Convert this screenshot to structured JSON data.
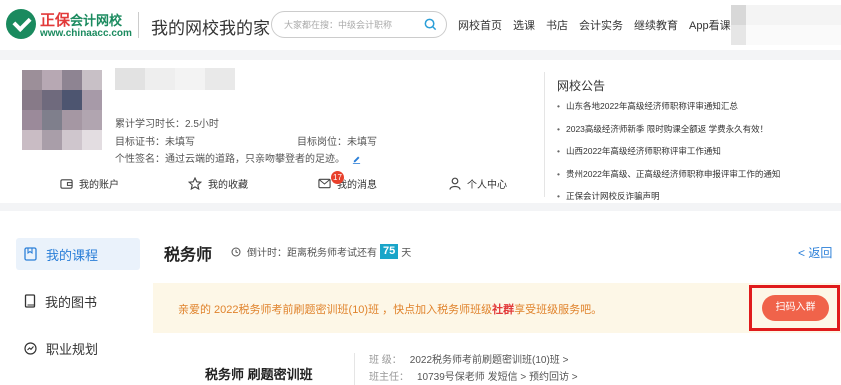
{
  "header": {
    "logo_main": "正保",
    "logo_sub": "会计网校",
    "logo_url": "www.chinaacc.com",
    "site_title": "我的网校我的家",
    "search_placeholder": "大家都在搜：中级会计职称",
    "nav": [
      "网校首页",
      "选课",
      "书店",
      "会计实务",
      "继续教育",
      "App看课"
    ]
  },
  "profile": {
    "study_time": "累计学习时长：2.5小时",
    "target_cert": "目标证书：未填写",
    "target_post": "目标岗位：未填写",
    "signature": "个性签名：通过云端的道路，只亲吻攀登者的足迹。",
    "quick_links": {
      "account": "我的账户",
      "favorites": "我的收藏",
      "messages": "我的消息",
      "personal": "个人中心"
    },
    "message_count": "17"
  },
  "notices": {
    "title": "网校公告",
    "items": [
      "山东各地2022年高级经济师职称评审通知汇总",
      "2023高级经济师新季 限时购课全额返 学费永久有效！",
      "山西2022年高级经济师职称评审工作通知",
      "贵州2022年高级、正高级经济师职称申报评审工作的通知",
      "正保会计网校反诈骗声明"
    ]
  },
  "sidebar": {
    "items": [
      "我的课程",
      "我的图书",
      "职业规划"
    ],
    "active_index": 0
  },
  "main": {
    "exam_title": "税务师",
    "countdown_prefix": "倒计时：距离税务师考试还有",
    "countdown_days": "75",
    "countdown_suffix": "天",
    "back_label": "< 返回",
    "promo_prefix": "亲爱的 2022税务师考前刷题密训班(10)班 ，快点加入税务师班级",
    "promo_bold": "社群",
    "promo_suffix": "享受班级服务吧。",
    "join_button": "扫码入群",
    "course_name": "税务师 刷题密训班",
    "class_label": "班 级：",
    "class_value": "2022税务师考前刷题密训班(10)班 >",
    "teacher_label": "班主任：",
    "teacher_value": "10739号保老师 发短信 > 预约回访 >"
  },
  "colors": {
    "brand_green": "#1a8a5e",
    "brand_red": "#e23a3a",
    "link_blue": "#2b7fd8",
    "promo_bg": "#fdf7e7",
    "join_button": "#f0634a",
    "highlight": "#e01b1b"
  }
}
